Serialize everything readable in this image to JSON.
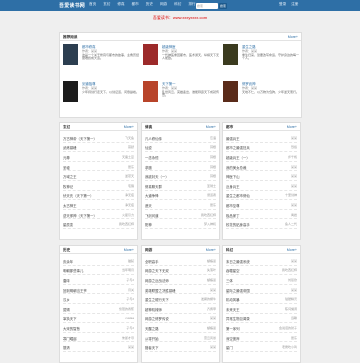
{
  "header": {
    "logo": "吾爱读书网",
    "nav": [
      "首页",
      "玄幻",
      "修真",
      "都市",
      "历史",
      "网游",
      "科幻",
      "排行"
    ],
    "search_placeholder": "搜索",
    "search_btn": "搜索",
    "links": [
      "登录",
      "注册"
    ]
  },
  "notice": "吾爱读书：www.xxxyxxxx.com",
  "featured": {
    "title": "推荐阅读",
    "more": "More+",
    "items": [
      {
        "title": "都市修真",
        "author": "作者：某某",
        "desc": "这是一个关于修真与都市的故事，主角历经磨难终成大道。",
        "cover": "#2c3e50"
      },
      {
        "title": "超级神医",
        "author": "作者：某某",
        "desc": "一代神医重回都市，医术通天，纵横天下无人能敌。",
        "cover": "#9c2a2a"
      },
      {
        "title": "重生之路",
        "author": "作者：某某",
        "desc": "重生归来，誓要改写命运，守护身边的每一个人。",
        "cover": "#3b3b1f"
      },
      {
        "title": "剑道独尊",
        "author": "作者：某某",
        "desc": "少年持剑行走天下，以剑证道，问鼎巅峰。",
        "cover": "#1c1c1c"
      },
      {
        "title": "天下第一",
        "author": "作者：某某",
        "desc": "乱世风云，英雄辈出，谁能称霸天下成就传奇。",
        "cover": "#b8442a"
      },
      {
        "title": "修罗武神",
        "author": "作者：某某",
        "desc": "天地不仁，以万物为刍狗，少年逆天而行。",
        "cover": "#5a2b1a"
      }
    ]
  },
  "sections": [
    {
      "title": "玄幻",
      "more": "More+",
      "rows": [
        {
          "n": "万古神帝（天下第一）",
          "a": "飞天鱼"
        },
        {
          "n": "武炼巅峰",
          "a": "莫默"
        },
        {
          "n": "元尊",
          "a": "天蚕土豆"
        },
        {
          "n": "圣墟",
          "a": "辰东"
        },
        {
          "n": "万域之王",
          "a": "逆苍天"
        },
        {
          "n": "牧神记",
          "a": "宅猪"
        },
        {
          "n": "伏天氏（天下第一）",
          "a": "净无痕"
        },
        {
          "n": "太古神王",
          "a": "净无痕"
        },
        {
          "n": "逆天邪神（天下第一）",
          "a": "火星引力"
        },
        {
          "n": "星辰变",
          "a": "我吃西红柿"
        }
      ]
    },
    {
      "title": "修真",
      "more": "More+",
      "rows": [
        {
          "n": "凡人修仙传",
          "a": "忘语"
        },
        {
          "n": "仙逆",
          "a": "耳根"
        },
        {
          "n": "一念永恒",
          "a": "耳根"
        },
        {
          "n": "求魔",
          "a": "耳根"
        },
        {
          "n": "我欲封天（一）",
          "a": "耳根"
        },
        {
          "n": "修真聊天群",
          "a": "圣骑士"
        },
        {
          "n": "大道争锋",
          "a": "误道者"
        },
        {
          "n": "遮天",
          "a": "辰东"
        },
        {
          "n": "飞剑问道",
          "a": "我吃西红柿"
        },
        {
          "n": "阳神",
          "a": "梦入神机"
        }
      ]
    },
    {
      "title": "都市",
      "more": "More+",
      "rows": [
        {
          "n": "最强兵王",
          "a": "某某"
        },
        {
          "n": "都市之最强狂兵",
          "a": "烈焰"
        },
        {
          "n": "超级兵王（一）",
          "a": "步千帆"
        },
        {
          "n": "我的美女总裁",
          "a": "某某"
        },
        {
          "n": "神医下山",
          "a": "某某"
        },
        {
          "n": "近身兵王",
          "a": "某某"
        },
        {
          "n": "重生之都市修仙",
          "a": "十里剑神"
        },
        {
          "n": "都市至尊",
          "a": "某某"
        },
        {
          "n": "极品家丁",
          "a": "禹岩"
        },
        {
          "n": "校花的贴身高手",
          "a": "鱼人二代"
        }
      ]
    },
    {
      "title": "历史",
      "more": "More+",
      "rows": [
        {
          "n": "庆余年",
          "a": "猫腻"
        },
        {
          "n": "明朝那些事儿",
          "a": "当年明月"
        },
        {
          "n": "唐砖",
          "a": "孑与2"
        },
        {
          "n": "回到明朝当王爷",
          "a": "月关"
        },
        {
          "n": "汉乡",
          "a": "孑与2"
        },
        {
          "n": "赘婿",
          "a": "愤怒的香蕉"
        },
        {
          "n": "宰执天下",
          "a": "cuslaa"
        },
        {
          "n": "大宋的智慧",
          "a": "孑与2"
        },
        {
          "n": "寒门崛起",
          "a": "朱郎才尽"
        },
        {
          "n": "篡清",
          "a": "某某"
        }
      ]
    },
    {
      "title": "网游",
      "more": "More+",
      "rows": [
        {
          "n": "全职高手",
          "a": "蝴蝶蓝"
        },
        {
          "n": "网游之天下无双",
          "a": "失落叶"
        },
        {
          "n": "网游之近战法师",
          "a": "蝴蝶蓝"
        },
        {
          "n": "英雄联盟之决胜巅峰",
          "a": "某某"
        },
        {
          "n": "重生之贼行天下",
          "a": "发飙的蜗牛"
        },
        {
          "n": "超神机械师",
          "a": "齐佩甲"
        },
        {
          "n": "网游之修罗传说",
          "a": "某某"
        },
        {
          "n": "天醒之路",
          "a": "蝴蝶蓝"
        },
        {
          "n": "从零开始",
          "a": "雷云风暴"
        },
        {
          "n": "猎者天下",
          "a": "某某"
        }
      ]
    },
    {
      "title": "科幻",
      "more": "More+",
      "rows": [
        {
          "n": "末日之最强系统",
          "a": "某某"
        },
        {
          "n": "吞噬星空",
          "a": "我吃西红柿"
        },
        {
          "n": "三体",
          "a": "刘慈欣"
        },
        {
          "n": "星际之最强帝国",
          "a": "某某"
        },
        {
          "n": "机动风暴",
          "a": "骷髅精灵"
        },
        {
          "n": "未来天王",
          "a": "陈词懒调"
        },
        {
          "n": "异常生物见闻录",
          "a": "远瞳"
        },
        {
          "n": "第一序列",
          "a": "会说话的肘子"
        },
        {
          "n": "深空彼岸",
          "a": "辰东"
        },
        {
          "n": "星门",
          "a": "老鹰吃小鸡"
        }
      ]
    }
  ]
}
